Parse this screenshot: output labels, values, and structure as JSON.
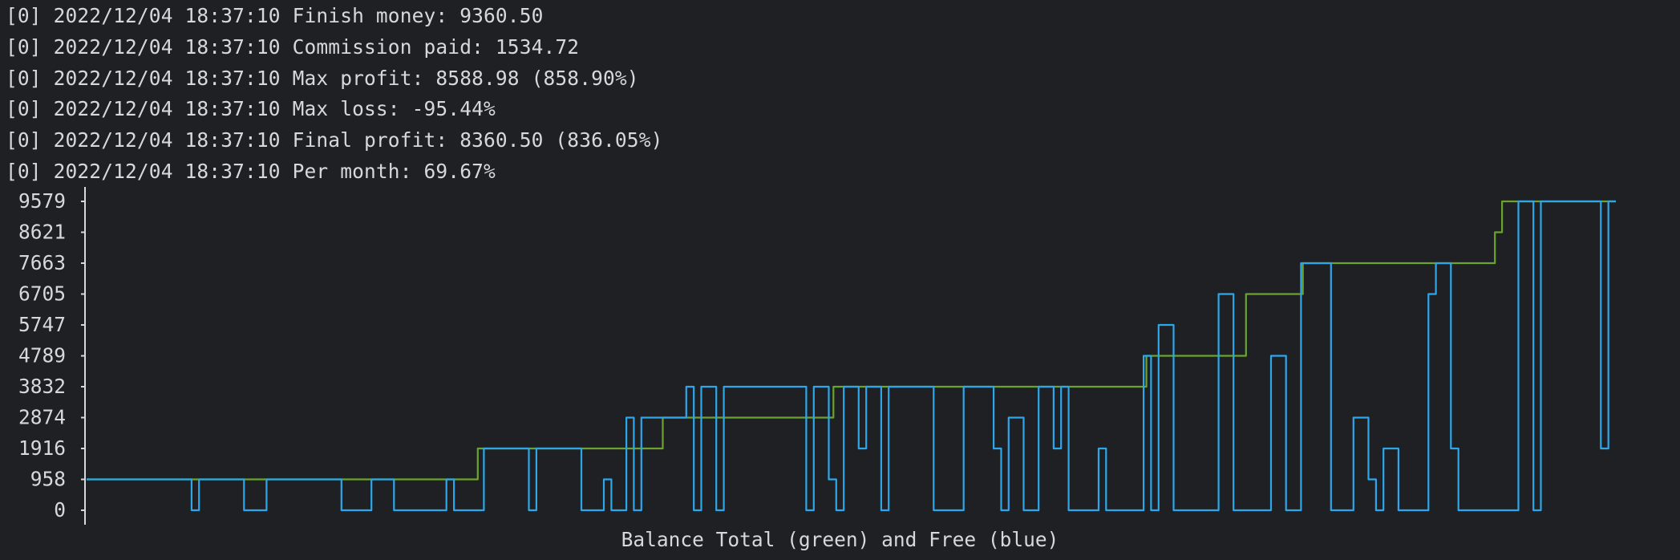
{
  "log": {
    "lines": [
      {
        "prefix": "[0]",
        "timestamp": "2022/12/04 18:37:10",
        "message": "Finish money: 9360.50"
      },
      {
        "prefix": "[0]",
        "timestamp": "2022/12/04 18:37:10",
        "message": "Commission paid: 1534.72"
      },
      {
        "prefix": "[0]",
        "timestamp": "2022/12/04 18:37:10",
        "message": "Max profit: 8588.98 (858.90%)"
      },
      {
        "prefix": "[0]",
        "timestamp": "2022/12/04 18:37:10",
        "message": "Max loss: -95.44%"
      },
      {
        "prefix": "[0]",
        "timestamp": "2022/12/04 18:37:10",
        "message": "Final profit: 8360.50 (836.05%)"
      },
      {
        "prefix": "[0]",
        "timestamp": "2022/12/04 18:37:10",
        "message": "Per month: 69.67%"
      }
    ]
  },
  "chart_data": {
    "type": "line",
    "title": "Balance Total (green) and Free (blue)",
    "xlabel": "",
    "ylabel": "",
    "y_ticks": [
      "9579",
      "8621",
      "7663",
      "6705",
      "5747",
      "4789",
      "3832",
      "2874",
      "1916",
      "958",
      "0"
    ],
    "ylim": [
      0,
      9579
    ],
    "grid": false,
    "colors": {
      "total": "#6aa42f",
      "free": "#2ea7ea",
      "axis": "#d6d8dc",
      "background": "#1f2024"
    },
    "series": [
      {
        "name": "Balance Total",
        "color": "#6aa42f",
        "values": [
          958,
          958,
          958,
          958,
          958,
          958,
          958,
          958,
          958,
          958,
          958,
          958,
          958,
          958,
          958,
          958,
          958,
          958,
          958,
          958,
          958,
          958,
          958,
          958,
          958,
          958,
          958,
          958,
          958,
          958,
          958,
          958,
          958,
          958,
          958,
          958,
          958,
          958,
          958,
          958,
          958,
          958,
          958,
          958,
          958,
          958,
          958,
          958,
          958,
          958,
          958,
          958,
          958,
          958,
          958,
          1916,
          1916,
          1916,
          1916,
          1916,
          1916,
          1916,
          1916,
          1916,
          1916,
          1916,
          1916,
          1916,
          1916,
          1916,
          1916,
          1916,
          1916,
          1916,
          1916,
          1916,
          1916,
          1916,
          1916,
          1916,
          1916,
          2874,
          2874,
          2874,
          2874,
          2874,
          2874,
          2874,
          2874,
          2874,
          2874,
          2874,
          2874,
          2874,
          2874,
          2874,
          2874,
          2874,
          2874,
          2874,
          2874,
          2874,
          2874,
          2874,
          2874,
          3832,
          3832,
          3832,
          3832,
          3832,
          3832,
          3832,
          3832,
          3832,
          3832,
          3832,
          3832,
          3832,
          3832,
          3832,
          3832,
          3832,
          3832,
          3832,
          3832,
          3832,
          3832,
          3832,
          3832,
          3832,
          3832,
          3832,
          3832,
          3832,
          3832,
          3832,
          3832,
          3832,
          3832,
          3832,
          3832,
          3832,
          3832,
          3832,
          3832,
          3832,
          3832,
          3832,
          3832,
          4789,
          4789,
          4789,
          4789,
          4789,
          4789,
          4789,
          4789,
          4789,
          4789,
          4789,
          4789,
          4789,
          4789,
          6705,
          6705,
          6705,
          6705,
          6705,
          6705,
          6705,
          6705,
          7663,
          7663,
          7663,
          7663,
          7663,
          7663,
          7663,
          7663,
          7663,
          7663,
          7663,
          7663,
          7663,
          7663,
          7663,
          7663,
          7663,
          7663,
          7663,
          7663,
          7663,
          7663,
          7663,
          7663,
          7663,
          7663,
          7663,
          8621,
          9579,
          9579,
          9579,
          9579,
          9579,
          9579,
          9579,
          9579,
          9579,
          9579,
          9579,
          9579,
          9579,
          9579,
          9579,
          9579
        ]
      },
      {
        "name": "Balance Free",
        "color": "#2ea7ea",
        "values": [
          958,
          958,
          958,
          958,
          958,
          958,
          958,
          958,
          958,
          958,
          958,
          958,
          958,
          958,
          0,
          958,
          958,
          958,
          958,
          958,
          958,
          0,
          0,
          0,
          958,
          958,
          958,
          958,
          958,
          958,
          958,
          958,
          958,
          958,
          0,
          0,
          0,
          0,
          958,
          958,
          958,
          0,
          0,
          0,
          0,
          0,
          0,
          0,
          958,
          0,
          0,
          0,
          0,
          1916,
          1916,
          1916,
          1916,
          1916,
          1916,
          0,
          1916,
          1916,
          1916,
          1916,
          1916,
          1916,
          0,
          0,
          0,
          958,
          0,
          0,
          2874,
          0,
          2874,
          2874,
          2874,
          2874,
          2874,
          2874,
          3832,
          0,
          3832,
          3832,
          0,
          3832,
          3832,
          3832,
          3832,
          3832,
          3832,
          3832,
          3832,
          3832,
          3832,
          3832,
          0,
          3832,
          3832,
          958,
          0,
          3832,
          3832,
          1916,
          3832,
          3832,
          0,
          3832,
          3832,
          3832,
          3832,
          3832,
          3832,
          0,
          0,
          0,
          0,
          3832,
          3832,
          3832,
          3832,
          1916,
          0,
          2874,
          2874,
          0,
          0,
          3832,
          3832,
          1916,
          3832,
          0,
          0,
          0,
          0,
          1916,
          0,
          0,
          0,
          0,
          0,
          4789,
          0,
          5747,
          5747,
          0,
          0,
          0,
          0,
          0,
          0,
          6705,
          6705,
          0,
          0,
          0,
          0,
          0,
          4789,
          4789,
          0,
          0,
          7663,
          7663,
          7663,
          7663,
          0,
          0,
          0,
          2874,
          2874,
          958,
          0,
          1916,
          1916,
          0,
          0,
          0,
          0,
          6705,
          7663,
          7663,
          1916,
          0,
          0,
          0,
          0,
          0,
          0,
          0,
          0,
          9579,
          9579,
          0,
          9579,
          9579,
          9579,
          9579,
          9579,
          9579,
          9579,
          9579,
          1916,
          9579
        ]
      }
    ],
    "caption": "Balance Total (green) and Free (blue)"
  }
}
